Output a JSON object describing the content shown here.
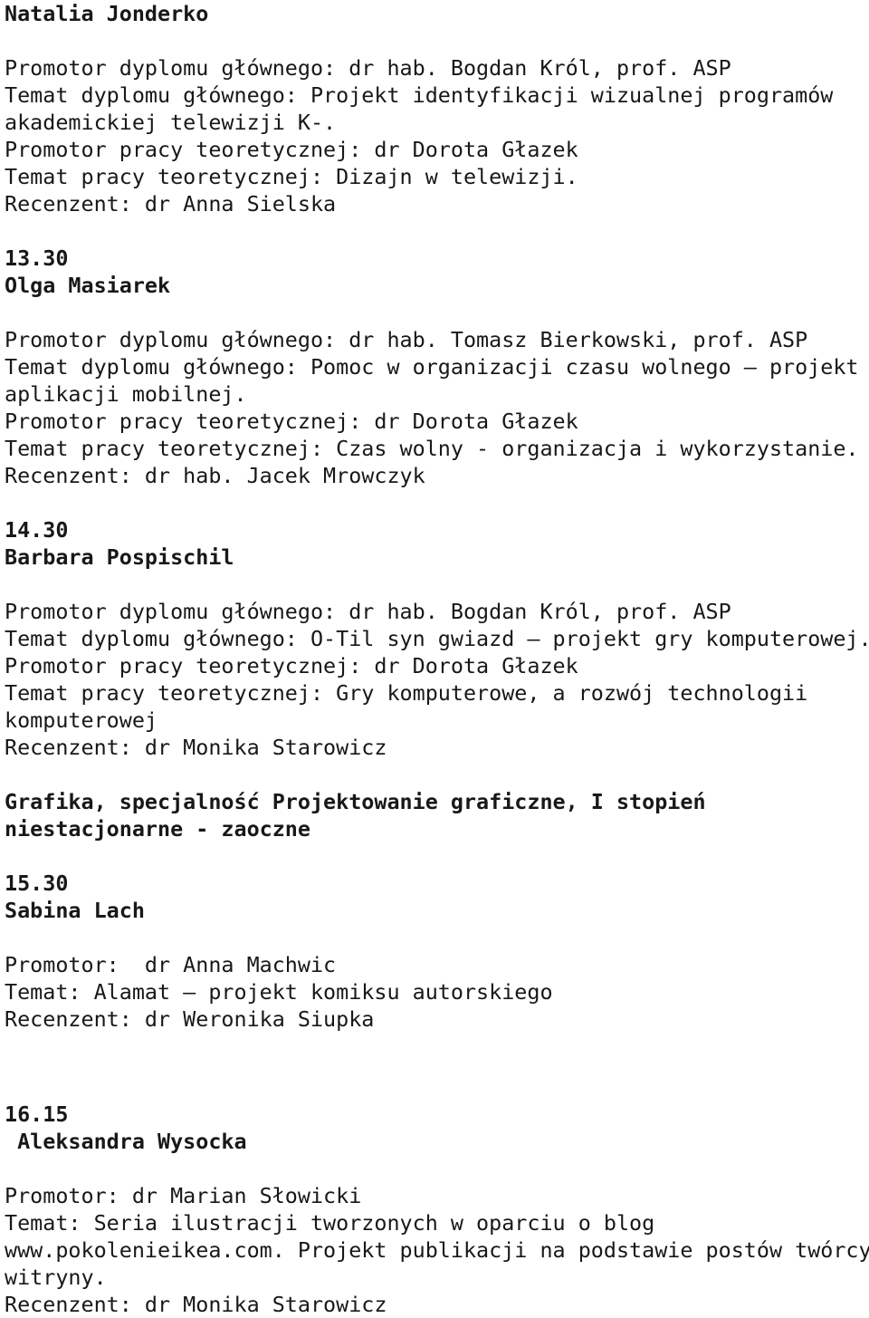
{
  "document": {
    "type": "thesis-defense-schedule",
    "language": "pl",
    "background_color": "#ffffff",
    "text_color": "#181818",
    "sections": [
      {
        "id": "natalia-jonderko",
        "heading_lines": [
          "Natalia Jonderko"
        ],
        "body_lines": [
          "Promotor dyplomu głównego: dr hab. Bogdan Król, prof. ASP",
          "Temat dyplomu głównego: Projekt identyfikacji wizualnej programów",
          "akademickiej telewizji K-.",
          "Promotor pracy teoretycznej: dr Dorota Głazek",
          "Temat pracy teoretycznej: Dizajn w telewizji.",
          "Recenzent: dr Anna Sielska"
        ]
      },
      {
        "id": "olga-masiarek",
        "heading_lines": [
          "13.30",
          "Olga Masiarek"
        ],
        "body_lines": [
          "Promotor dyplomu głównego: dr hab. Tomasz Bierkowski, prof. ASP",
          "Temat dyplomu głównego: Pomoc w organizacji czasu wolnego – projekt",
          "aplikacji mobilnej.",
          "Promotor pracy teoretycznej: dr Dorota Głazek",
          "Temat pracy teoretycznej: Czas wolny - organizacja i wykorzystanie.",
          "Recenzent: dr hab. Jacek Mrowczyk"
        ]
      },
      {
        "id": "barbara-pospischil",
        "heading_lines": [
          "14.30",
          "Barbara Pospischil"
        ],
        "body_lines": [
          "Promotor dyplomu głównego: dr hab. Bogdan Król, prof. ASP",
          "Temat dyplomu głównego: O-Til syn gwiazd – projekt gry komputerowej.",
          "Promotor pracy teoretycznej: dr Dorota Głazek",
          "Temat pracy teoretycznej: Gry komputerowe, a rozwój technologii",
          "komputerowej",
          "Recenzent: dr Monika Starowicz"
        ]
      },
      {
        "id": "program-heading",
        "heading_lines": [
          "Grafika, specjalność Projektowanie graficzne, I stopień",
          "niestacjonarne - zaoczne"
        ],
        "body_lines": []
      },
      {
        "id": "sabina-lach",
        "heading_lines": [
          "15.30",
          "Sabina Lach"
        ],
        "body_lines": [
          "Promotor:  dr Anna Machwic",
          "Temat: Alamat – projekt komiksu autorskiego",
          "Recenzent: dr Weronika Siupka"
        ]
      },
      {
        "id": "aleksandra-wysocka",
        "heading_lines": [
          "16.15",
          " Aleksandra Wysocka"
        ],
        "body_lines": [
          "Promotor: dr Marian Słowicki",
          "Temat: Seria ilustracji tworzonych w oparciu o blog",
          "www.pokolenieikea.com. Projekt publikacji na podstawie postów twórcy",
          "witryny.",
          "Recenzent: dr Monika Starowicz"
        ]
      }
    ]
  }
}
